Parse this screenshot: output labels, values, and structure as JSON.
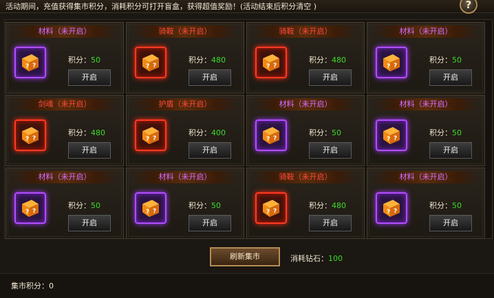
{
  "notice": "活动期间，充值获得集市积分，消耗积分可打开盲盒，获得超值奖励！(活动结束后积分清空 )",
  "help_label": "?",
  "score_prefix": "积分：",
  "open_label": "开启",
  "cards": [
    {
      "title": "材料（未开启）",
      "color": "purple",
      "score": "50"
    },
    {
      "title": "骑鞍（未开启）",
      "color": "red",
      "score": "480"
    },
    {
      "title": "骑鞍（未开启）",
      "color": "red",
      "score": "480"
    },
    {
      "title": "材料（未开启）",
      "color": "purple",
      "score": "50"
    },
    {
      "title": "剑魂（未开启）",
      "color": "red",
      "score": "480"
    },
    {
      "title": "护盾（未开启）",
      "color": "red",
      "score": "400"
    },
    {
      "title": "材料（未开启）",
      "color": "purple",
      "score": "50"
    },
    {
      "title": "材料（未开启）",
      "color": "purple",
      "score": "50"
    },
    {
      "title": "材料（未开启）",
      "color": "purple",
      "score": "50"
    },
    {
      "title": "材料（未开启）",
      "color": "purple",
      "score": "50"
    },
    {
      "title": "骑鞍（未开启）",
      "color": "red",
      "score": "480"
    },
    {
      "title": "材料（未开启）",
      "color": "purple",
      "score": "50"
    }
  ],
  "refresh_label": "刷新集市",
  "cost_label": "消耗钻石：",
  "cost_value": "100",
  "points_label": "集市积分：0",
  "colors": {
    "purple_title": "#d86cff",
    "red_title": "#ff4a3a",
    "score_green": "#3cdc2a"
  }
}
